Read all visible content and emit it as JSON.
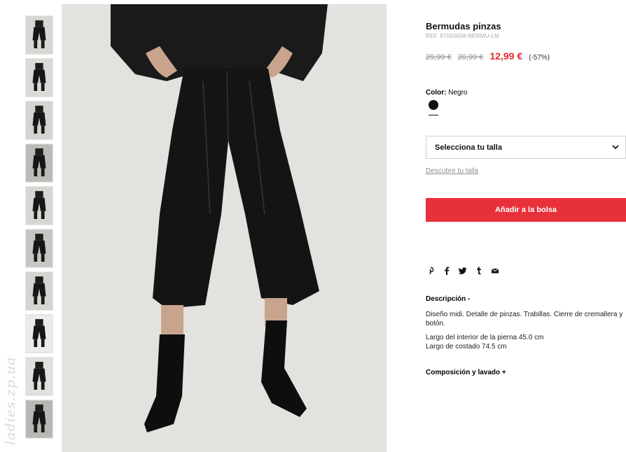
{
  "product": {
    "title": "Bermudas pinzas",
    "reference": "REF. 67050608-BERMU-LM",
    "prices": {
      "original_1": "29,99 €",
      "original_2": "20,99 €",
      "current": "12,99 €",
      "discount": "(-57%)"
    },
    "color": {
      "label": "Color:",
      "value": "Negro"
    },
    "size_select": {
      "placeholder": "Selecciona tu talla"
    },
    "size_guide_link": "Descubre tu talla",
    "add_to_bag": "Añadir a la bolsa",
    "share_icons": [
      "pinterest-icon",
      "facebook-icon",
      "twitter-icon",
      "tumblr-icon",
      "email-icon"
    ],
    "description": {
      "heading": "Descripción -",
      "text": "Diseño midi. Detalle de pinzas. Trabillas. Cierre de cremallera y botón.",
      "inner_leg": "Largo del interior de la pierna 45.0 cm",
      "side_length": "Largo de costado 74.5 cm"
    },
    "composition_toggle": "Composición y lavado +"
  },
  "gallery": {
    "thumbnail_count": 10
  },
  "watermark": "ladies.zp.ua",
  "colors": {
    "accent_red": "#e8303b",
    "price_red": "#e22b2b",
    "swatch": "#111111"
  }
}
